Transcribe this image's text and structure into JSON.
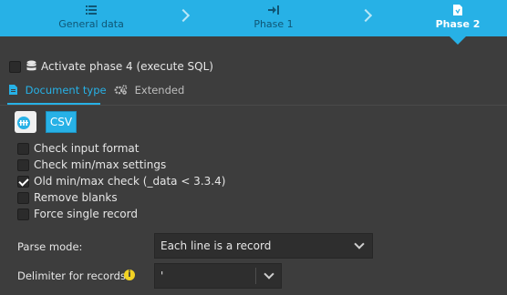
{
  "wizard": {
    "steps": [
      {
        "label": "General data",
        "icon": "list-icon",
        "active": false
      },
      {
        "label": "Phase 1",
        "icon": "arrow-to-right-icon",
        "active": false
      },
      {
        "label": "Phase 2",
        "icon": "document-icon",
        "active": true
      }
    ]
  },
  "activate_phase4": {
    "label": "Activate phase 4 (execute SQL)",
    "checked": false,
    "icon": "database-icon"
  },
  "tabs": [
    {
      "label": "Document type",
      "icon": "file-icon",
      "active": true
    },
    {
      "label": "Extended",
      "icon": "cogs-icon",
      "active": false
    }
  ],
  "doc_type": {
    "icon": "table-file-icon",
    "button_label": "CSV"
  },
  "options": [
    {
      "label": "Check input format",
      "checked": false
    },
    {
      "label": "Check min/max settings",
      "checked": false
    },
    {
      "label": "Old min/max check (_data < 3.3.4)",
      "checked": true
    },
    {
      "label": "Remove blanks",
      "checked": false
    },
    {
      "label": "Force single record",
      "checked": false
    }
  ],
  "parse_mode": {
    "label": "Parse mode:",
    "value": "Each line is a record"
  },
  "delimiter": {
    "label": "Delimiter for records:",
    "value": "'"
  },
  "colors": {
    "accent": "#27b1e6",
    "background": "#3d3d3d",
    "info": "#f2d224"
  }
}
